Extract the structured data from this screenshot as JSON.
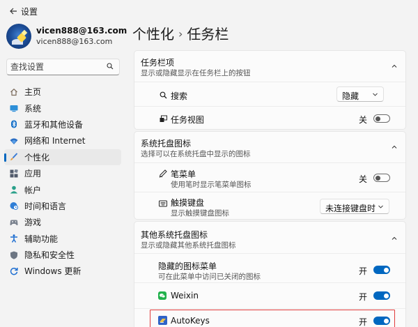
{
  "window": {
    "title": "设置",
    "back_icon": "back-arrow-icon"
  },
  "profile": {
    "name": "vicen888@163.com",
    "email": "vicen888@163.com"
  },
  "search": {
    "placeholder": "查找设置",
    "value": ""
  },
  "sidebar": {
    "items": [
      {
        "label": "主页",
        "icon": "home-icon",
        "active": false
      },
      {
        "label": "系统",
        "icon": "system-display-icon",
        "active": false
      },
      {
        "label": "蓝牙和其他设备",
        "icon": "bluetooth-icon",
        "active": false
      },
      {
        "label": "网络和 Internet",
        "icon": "wifi-icon",
        "active": false
      },
      {
        "label": "个性化",
        "icon": "brush-icon",
        "active": true
      },
      {
        "label": "应用",
        "icon": "apps-icon",
        "active": false
      },
      {
        "label": "帐户",
        "icon": "account-icon",
        "active": false
      },
      {
        "label": "时间和语言",
        "icon": "globe-clock-icon",
        "active": false
      },
      {
        "label": "游戏",
        "icon": "gamepad-icon",
        "active": false
      },
      {
        "label": "辅助功能",
        "icon": "accessibility-icon",
        "active": false
      },
      {
        "label": "隐私和安全性",
        "icon": "shield-icon",
        "active": false
      },
      {
        "label": "Windows 更新",
        "icon": "update-icon",
        "active": false
      }
    ]
  },
  "breadcrumb": {
    "parent": "个性化",
    "separator": "›",
    "current": "任务栏"
  },
  "sections": {
    "taskbar_items": {
      "title": "任务栏项",
      "subtitle": "显示或隐藏显示在任务栏上的按钮",
      "search": {
        "label": "搜索",
        "value": "隐藏"
      },
      "task_view": {
        "label": "任务视图",
        "state": "关"
      }
    },
    "tray_icons": {
      "title": "系统托盘图标",
      "subtitle": "选择可以在系统托盘中显示的图标",
      "pen": {
        "label": "笔菜单",
        "sub": "使用笔时显示笔菜单图标",
        "state": "关"
      },
      "touch_keyboard": {
        "label": "触摸键盘",
        "sub": "显示触摸键盘图标",
        "value": "未连接键盘时"
      }
    },
    "other_tray": {
      "title": "其他系统托盘图标",
      "subtitle": "显示或隐藏其他系统托盘图标",
      "hidden_menu": {
        "label": "隐藏的图标菜单",
        "sub": "可在此菜单中访问已关闭的图标",
        "state": "开"
      },
      "weixin": {
        "label": "Weixin",
        "state": "开"
      },
      "autokeys": {
        "label": "AutoKeys",
        "state": "开"
      }
    }
  },
  "colors": {
    "accent": "#0067c0",
    "highlight": "#e03a3a",
    "background": "#f3f3f3",
    "card": "#fbfbfb"
  }
}
